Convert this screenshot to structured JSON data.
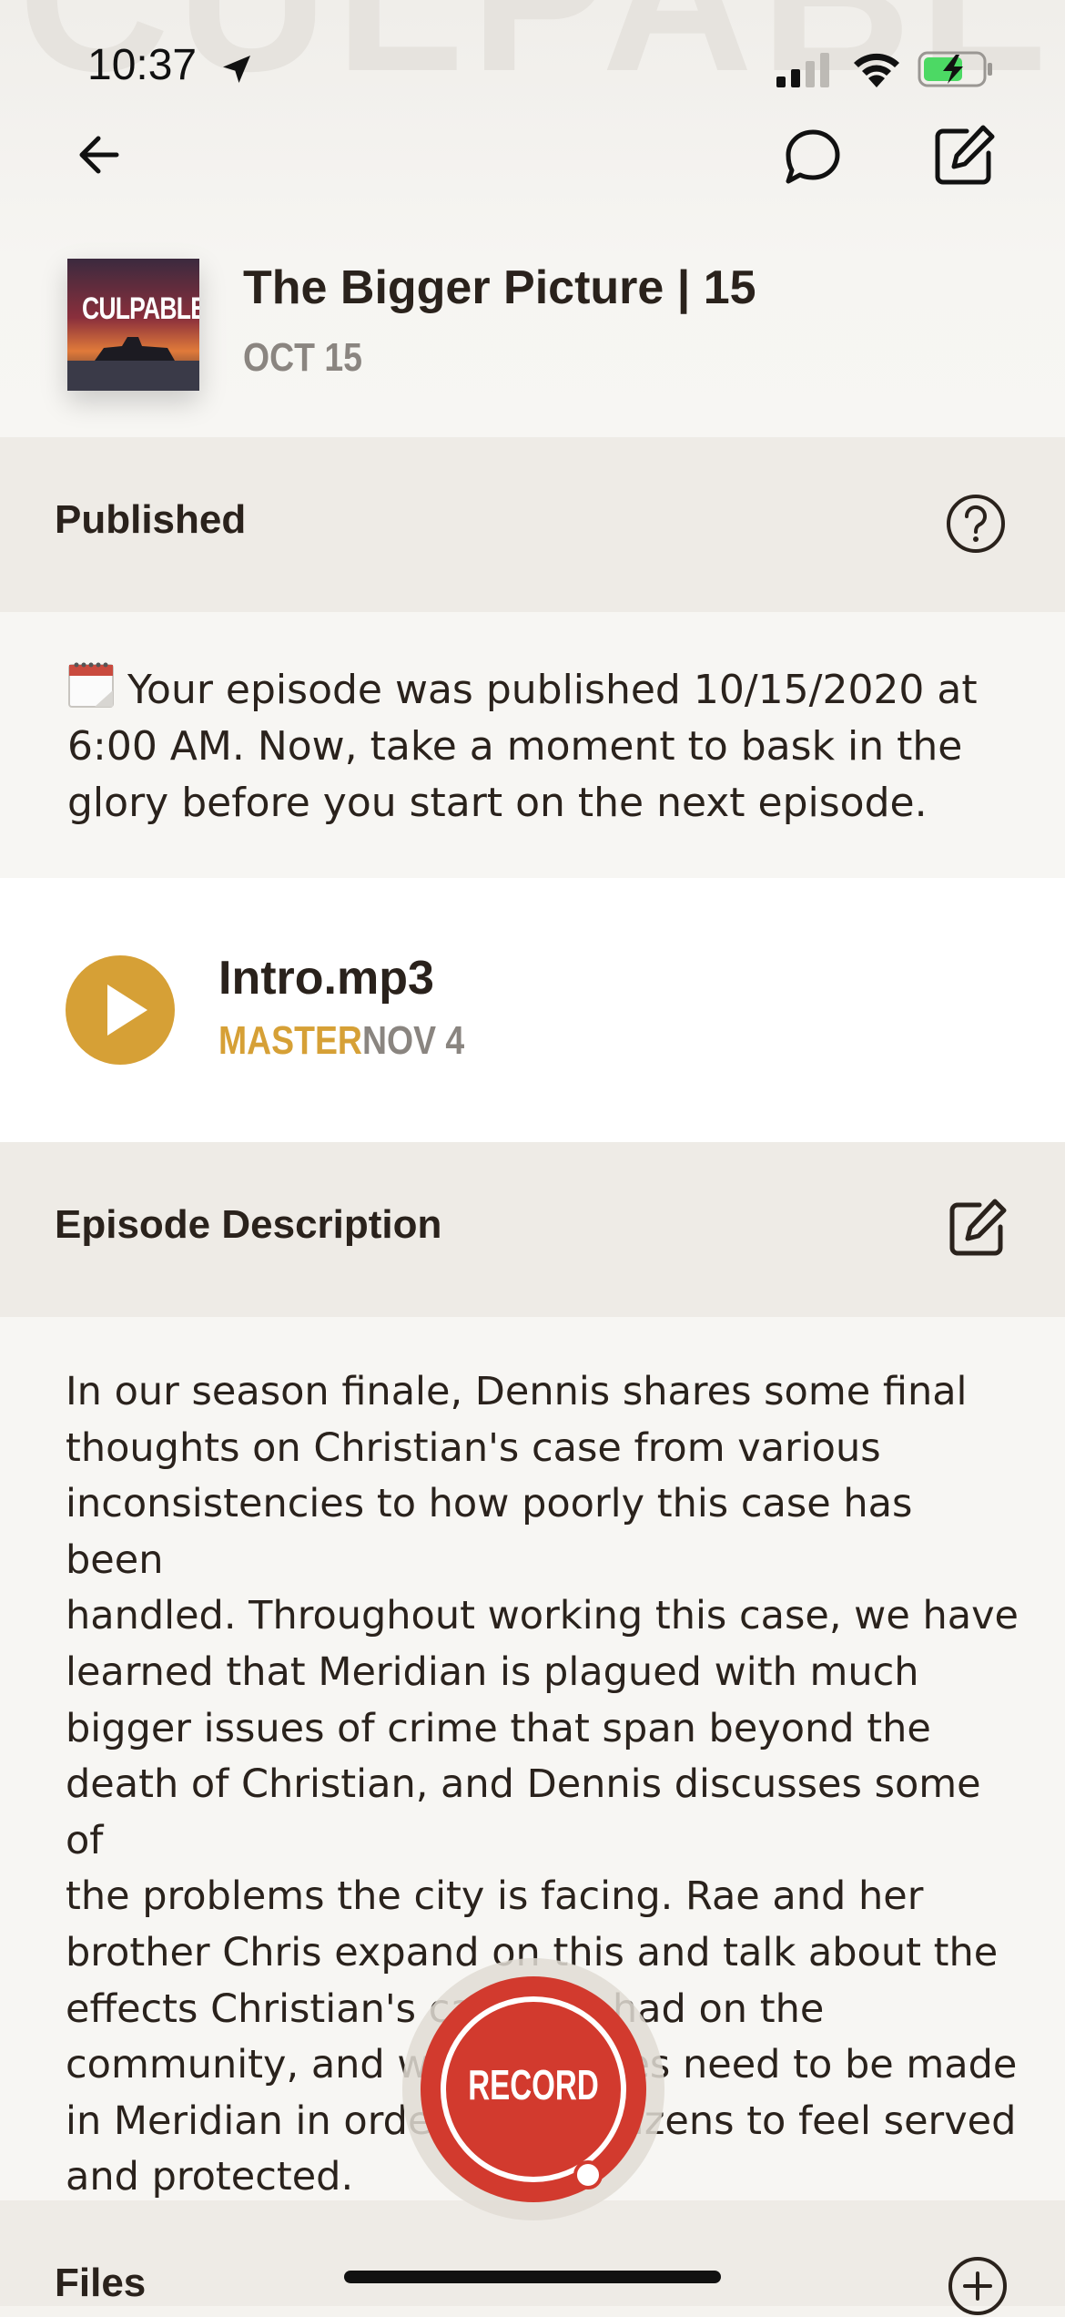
{
  "status_bar": {
    "time": "10:37"
  },
  "header": {
    "artwork_text": "CULPABLE",
    "watermark_text": "CULPABLE",
    "episode_title": "The Bigger Picture | 15",
    "episode_date": "OCT 15"
  },
  "published": {
    "section_title": "Published",
    "message": "Your episode was published 10/15/2020 at 6:00 AM. Now, take a moment to bask in the glory before you start on the next episode."
  },
  "audio": {
    "file_name": "Intro.mp3",
    "tag": "MASTER",
    "date": "NOV 4"
  },
  "description": {
    "section_title": "Episode Description",
    "text": "In our season finale, Dennis shares some final\nthoughts on Christian's case from various\ninconsistencies to how poorly this case has been\nhandled. Throughout working this case, we have\nlearned that Meridian is plagued with much\nbigger issues of crime that span beyond the\ndeath of Christian, and Dennis discusses some of\nthe problems the city is facing. Rae and her\nbrother Chris expand on this and talk about the\neffects Christian's case has had on the\ncommunity, and what changes need to be made\nin Meridian in order for its citizens to feel served\nand protected.\nhttps://culpablepodcast.com"
  },
  "files": {
    "section_title": "Files"
  },
  "record": {
    "label": "RECORD"
  },
  "colors": {
    "accent_gold": "#d6a036",
    "record_red": "#d23a2e",
    "section_bg": "#eeebe6",
    "text_dark": "#2a221c"
  },
  "icons": [
    "back-arrow-icon",
    "chat-bubble-icon",
    "edit-icon",
    "help-icon",
    "calendar-icon",
    "play-icon",
    "plus-circle-icon"
  ]
}
